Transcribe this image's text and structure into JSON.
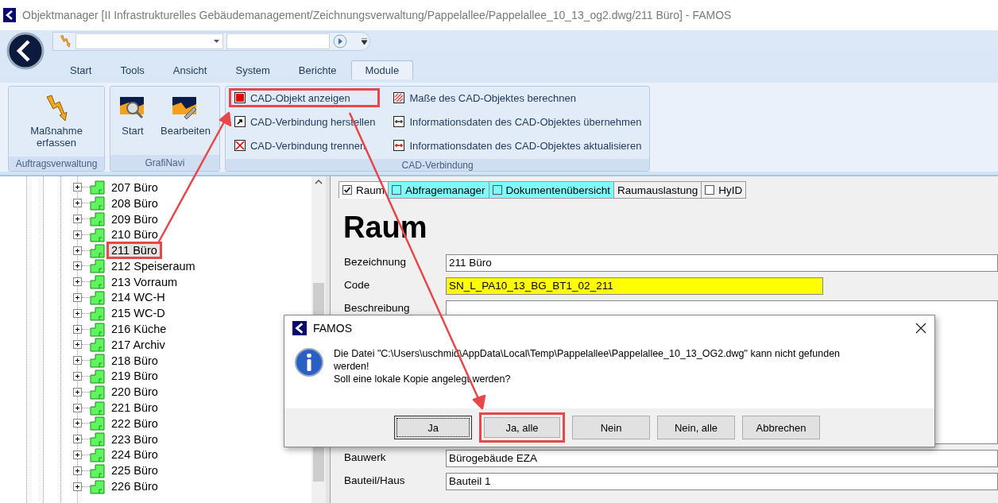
{
  "window": {
    "title": "Objektmanager [II  Infrastrukturelles Gebäudemanagement/Zeichnungsverwaltung/Pappelallee/Pappelallee_10_13_og2.dwg/211 Büro] - FAMOS"
  },
  "ribbon": {
    "tabs": [
      {
        "label": "Start",
        "selected": false
      },
      {
        "label": "Tools",
        "selected": false
      },
      {
        "label": "Ansicht",
        "selected": false
      },
      {
        "label": "System",
        "selected": false
      },
      {
        "label": "Berichte",
        "selected": false
      },
      {
        "label": "Module",
        "selected": true
      }
    ],
    "groups": [
      {
        "label": "Auftragsverwaltung",
        "kind": "large",
        "buttons": [
          {
            "label": "Maßnahme erfassen",
            "annotated": false
          }
        ]
      },
      {
        "label": "GrafiNavi",
        "kind": "large",
        "buttons": [
          {
            "label": "Start",
            "annotated": false
          },
          {
            "label": "Bearbeiten",
            "annotated": false
          }
        ]
      },
      {
        "label": "CAD-Verbindung",
        "kind": "small",
        "buttons": [
          {
            "label": "CAD-Objekt anzeigen",
            "annotated": true
          },
          {
            "label": "CAD-Verbindung herstellen",
            "annotated": false
          },
          {
            "label": "CAD-Verbindung trennen",
            "annotated": false
          },
          {
            "label": "Maße des CAD-Objektes berechnen",
            "annotated": false
          },
          {
            "label": "Informationsdaten des CAD-Objektes übernehmen",
            "annotated": false
          },
          {
            "label": "Informationsdaten des CAD-Objektes aktualisieren",
            "annotated": false
          }
        ]
      }
    ]
  },
  "tree": {
    "items": [
      {
        "label": "207 Büro",
        "selected": false,
        "annotated": false
      },
      {
        "label": "208 Büro",
        "selected": false,
        "annotated": false
      },
      {
        "label": "209 Büro",
        "selected": false,
        "annotated": false
      },
      {
        "label": "210 Büro",
        "selected": false,
        "annotated": false
      },
      {
        "label": "211 Büro",
        "selected": true,
        "annotated": true
      },
      {
        "label": "212 Speiseraum",
        "selected": false,
        "annotated": false
      },
      {
        "label": "213 Vorraum",
        "selected": false,
        "annotated": false
      },
      {
        "label": "214 WC-H",
        "selected": false,
        "annotated": false
      },
      {
        "label": "215 WC-D",
        "selected": false,
        "annotated": false
      },
      {
        "label": "216 Küche",
        "selected": false,
        "annotated": false
      },
      {
        "label": "217 Archiv",
        "selected": false,
        "annotated": false
      },
      {
        "label": "218 Büro",
        "selected": false,
        "annotated": false
      },
      {
        "label": "219 Büro",
        "selected": false,
        "annotated": false
      },
      {
        "label": "220 Büro",
        "selected": false,
        "annotated": false
      },
      {
        "label": "221 Büro",
        "selected": false,
        "annotated": false
      },
      {
        "label": "222 Büro",
        "selected": false,
        "annotated": false
      },
      {
        "label": "223 Büro",
        "selected": false,
        "annotated": false
      },
      {
        "label": "224 Büro",
        "selected": false,
        "annotated": false
      },
      {
        "label": "225 Büro",
        "selected": false,
        "annotated": false
      },
      {
        "label": "226 Büro",
        "selected": false,
        "annotated": false
      }
    ]
  },
  "detail": {
    "tabs": [
      {
        "label": "Raum",
        "kind": "checkbox",
        "checked": true,
        "highlighted": false,
        "selected": true
      },
      {
        "label": "Abfragemanager",
        "kind": "checkbox",
        "checked": false,
        "highlighted": true,
        "selected": false
      },
      {
        "label": "Dokumentenübersicht",
        "kind": "checkbox",
        "checked": false,
        "highlighted": true,
        "selected": false
      },
      {
        "label": "Raumauslastung",
        "kind": "plain",
        "highlighted": false,
        "selected": false
      },
      {
        "label": "HyID",
        "kind": "checkbox",
        "checked": false,
        "highlighted": false,
        "selected": false
      }
    ],
    "heading": "Raum",
    "fields": [
      {
        "label": "Bezeichnung",
        "kind": "text",
        "value": "211 Büro",
        "highlighted": false
      },
      {
        "label": "Code",
        "kind": "short",
        "value": "SN_L_PA10_13_BG_BT1_02_211",
        "highlighted": true
      },
      {
        "label": "Beschreibung",
        "kind": "multiline",
        "highlighted": false
      },
      {
        "label": "Bauwerk",
        "kind": "text",
        "value": "Bürogebäude EZA",
        "highlighted": false
      },
      {
        "label": "Bauteil/Haus",
        "kind": "text",
        "value": "Bauteil 1",
        "highlighted": false
      }
    ]
  },
  "dialog": {
    "title": "FAMOS",
    "message": [
      "Die Datei \"C:\\Users\\uschmid\\AppData\\Local\\Temp\\Pappelallee\\Pappelallee_10_13_OG2.dwg\" kann nicht gefunden werden!",
      "Soll eine lokale Kopie angelegt werden?"
    ],
    "buttons": [
      {
        "label": "Ja",
        "focused": true,
        "annotated": false
      },
      {
        "label": "Ja, alle",
        "focused": false,
        "annotated": true
      },
      {
        "label": "Nein",
        "focused": false,
        "annotated": false
      },
      {
        "label": "Nein, alle",
        "focused": false,
        "annotated": false
      },
      {
        "label": "Abbrechen",
        "focused": false,
        "annotated": false
      }
    ]
  }
}
